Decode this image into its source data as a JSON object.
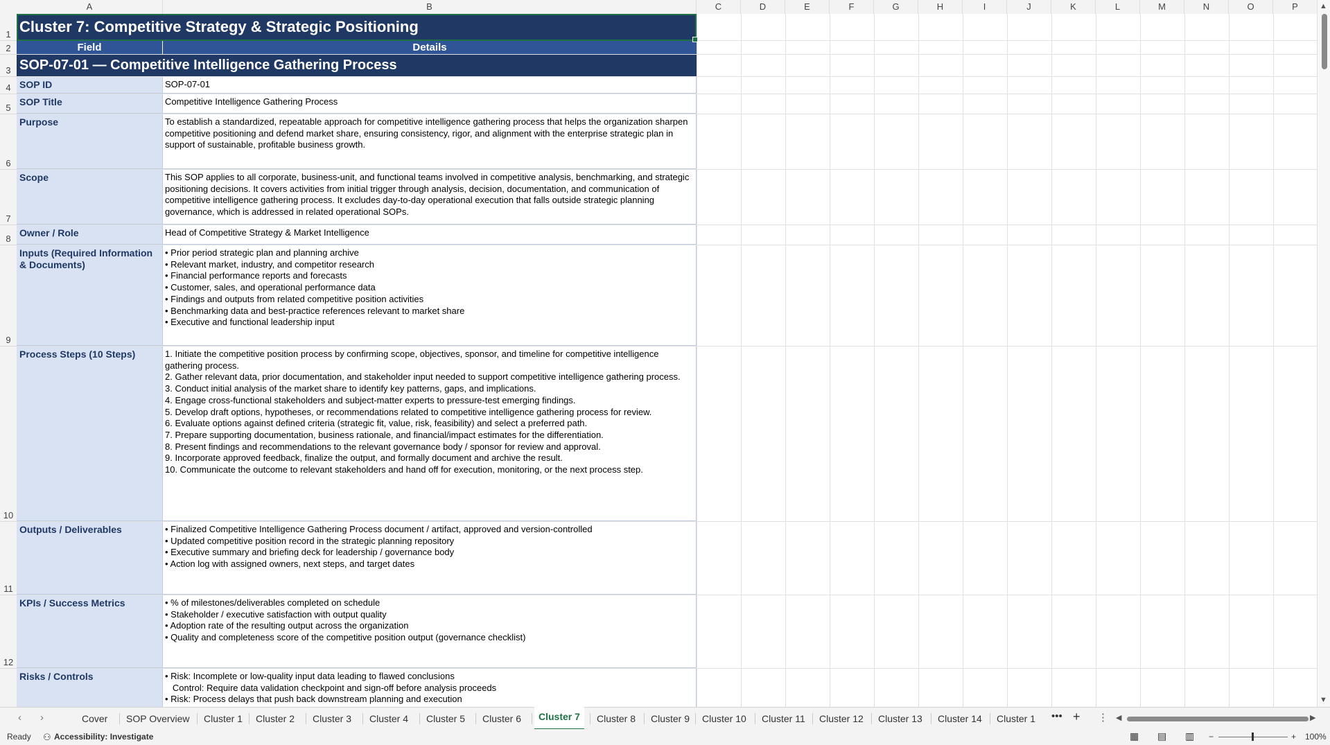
{
  "columns": [
    "A",
    "B",
    "C",
    "D",
    "E",
    "F",
    "G",
    "H",
    "I",
    "J",
    "K",
    "L",
    "M",
    "N",
    "O",
    "P"
  ],
  "rows": [
    "1",
    "2",
    "3",
    "4",
    "5",
    "6",
    "7",
    "8",
    "9",
    "10",
    "11",
    "12"
  ],
  "cluster_title": "Cluster 7: Competitive Strategy & Strategic Positioning",
  "header": {
    "field": "Field",
    "details": "Details"
  },
  "sop_heading": "SOP-07-01  —  Competitive Intelligence Gathering Process",
  "fields": [
    {
      "label": "SOP ID",
      "value": "SOP-07-01"
    },
    {
      "label": "SOP Title",
      "value": "Competitive Intelligence Gathering Process"
    },
    {
      "label": "Purpose",
      "value": "To establish a standardized, repeatable approach for competitive intelligence gathering process that helps the organization sharpen competitive positioning and defend market share, ensuring consistency, rigor, and alignment with the enterprise strategic plan in support of sustainable, profitable business growth."
    },
    {
      "label": "Scope",
      "value": "This SOP applies to all corporate, business-unit, and functional teams involved in competitive analysis, benchmarking, and strategic positioning decisions. It covers activities from initial trigger through analysis, decision, documentation, and communication of competitive intelligence gathering process. It excludes day-to-day operational execution that falls outside strategic planning governance, which is addressed in related operational SOPs."
    },
    {
      "label": "Owner / Role",
      "value": "Head of Competitive Strategy & Market Intelligence"
    },
    {
      "label": "Inputs (Required Information & Documents)",
      "value": "• Prior period strategic plan and planning archive\n• Relevant market, industry, and competitor research\n• Financial performance reports and forecasts\n• Customer, sales, and operational performance data\n• Findings and outputs from related competitive position activities\n• Benchmarking data and best-practice references relevant to market share\n• Executive and functional leadership input"
    },
    {
      "label": "Process Steps (10 Steps)",
      "value": "1. Initiate the competitive position process by confirming scope, objectives, sponsor, and timeline for competitive intelligence gathering process.\n2. Gather relevant data, prior documentation, and stakeholder input needed to support competitive intelligence gathering process.\n3. Conduct initial analysis of the market share to identify key patterns, gaps, and implications.\n4. Engage cross-functional stakeholders and subject-matter experts to pressure-test emerging findings.\n5. Develop draft options, hypotheses, or recommendations related to competitive intelligence gathering process for review.\n6. Evaluate options against defined criteria (strategic fit, value, risk, feasibility) and select a preferred path.\n7. Prepare supporting documentation, business rationale, and financial/impact estimates for the differentiation.\n8. Present findings and recommendations to the relevant governance body / sponsor for review and approval.\n9. Incorporate approved feedback, finalize the output, and formally document and archive the result.\n10. Communicate the outcome to relevant stakeholders and hand off for execution, monitoring, or the next process step."
    },
    {
      "label": "Outputs / Deliverables",
      "value": "• Finalized Competitive Intelligence Gathering Process document / artifact, approved and version-controlled\n• Updated competitive position record in the strategic planning repository\n• Executive summary and briefing deck for leadership / governance body\n• Action log with assigned owners, next steps, and target dates"
    },
    {
      "label": "KPIs / Success Metrics",
      "value": "• % of milestones/deliverables completed on schedule\n• Stakeholder / executive satisfaction with output quality\n• Adoption rate of the resulting output across the organization\n• Quality and completeness score of the competitive position output (governance checklist)"
    },
    {
      "label": "Risks / Controls",
      "value": "• Risk: Incomplete or low-quality input data leading to flawed conclusions\n   Control: Require data validation checkpoint and sign-off before analysis proceeds\n• Risk: Process delays that push back downstream planning and execution"
    }
  ],
  "tabs": [
    "Cover",
    "SOP Overview",
    "Cluster 1",
    "Cluster 2",
    "Cluster 3",
    "Cluster 4",
    "Cluster 5",
    "Cluster 6",
    "Cluster 7",
    "Cluster 8",
    "Cluster 9",
    "Cluster 10",
    "Cluster 11",
    "Cluster 12",
    "Cluster 13",
    "Cluster 14",
    "Cluster 1"
  ],
  "active_tab": "Cluster 7",
  "status": {
    "ready": "Ready",
    "accessibility": "Accessibility: Investigate",
    "zoom": "100%"
  },
  "colors": {
    "title_bg": "#1f3864",
    "header_bg": "#2f5597",
    "field_bg": "#d9e2f3",
    "accent": "#1e7145"
  }
}
